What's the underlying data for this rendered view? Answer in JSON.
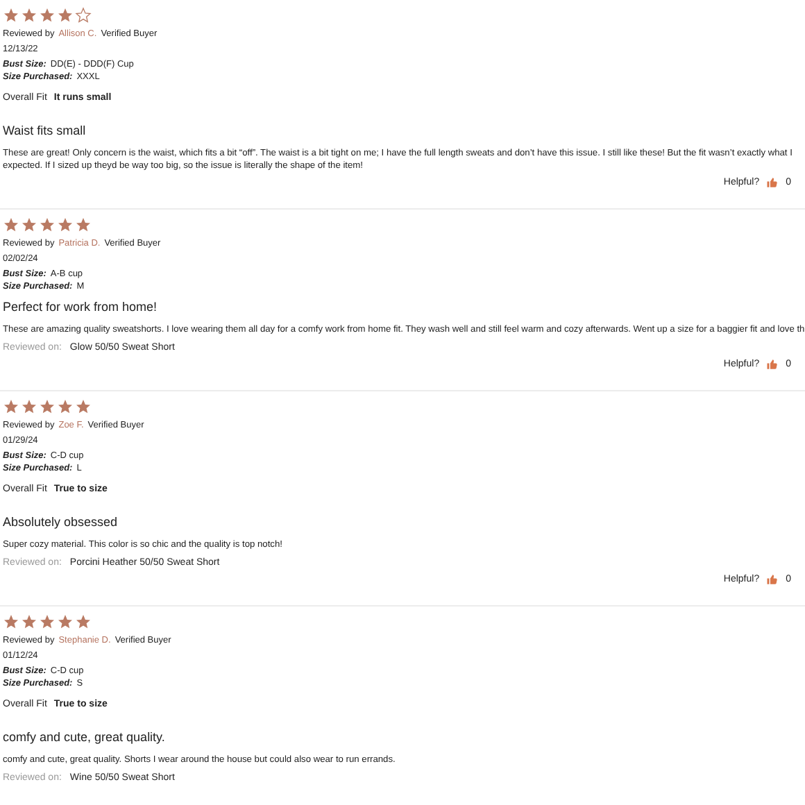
{
  "reviews": [
    {
      "stars": 4,
      "reviewed_by_label": "Reviewed by",
      "reviewer": "Allison C.",
      "badge": "Verified Buyer",
      "date": "12/13/22",
      "bust_size_label": "Bust Size:",
      "bust_size": "DD(E) - DDD(F) Cup",
      "size_purchased_label": "Size Purchased:",
      "size_purchased": "XXXL",
      "overall_fit_label": "Overall Fit",
      "overall_fit": "It runs small",
      "title": "Waist fits small",
      "body": [
        "These are great! Only concern is the waist, which fits a bit “off”. The waist is a bit tight on me; I have the full length sweats and don’t have this issue. I still like these! But the fit wasn’t exactly what I",
        "expected. If I sized up theyd be way too big, so the issue is literally the shape of the item!"
      ],
      "helpful_label": "Helpful?",
      "helpful_count": "0"
    },
    {
      "stars": 5,
      "reviewed_by_label": "Reviewed by",
      "reviewer": "Patricia D.",
      "badge": "Verified Buyer",
      "date": "02/02/24",
      "bust_size_label": "Bust Size:",
      "bust_size": "A-B cup",
      "size_purchased_label": "Size Purchased:",
      "size_purchased": "M",
      "title": "Perfect for work from home!",
      "body": [
        "These are amazing quality sweatshorts. I love wearing them all day for a comfy work from home fit. They wash well and still feel warm and cozy afterwards. Went up a size for a baggier fit and love th"
      ],
      "reviewed_on_label": "Reviewed on:",
      "reviewed_on": "Glow 50/50 Sweat Short",
      "helpful_label": "Helpful?",
      "helpful_count": "0"
    },
    {
      "stars": 5,
      "reviewed_by_label": "Reviewed by",
      "reviewer": "Zoe F.",
      "badge": "Verified Buyer",
      "date": "01/29/24",
      "bust_size_label": "Bust Size:",
      "bust_size": "C-D cup",
      "size_purchased_label": "Size Purchased:",
      "size_purchased": "L",
      "overall_fit_label": "Overall Fit",
      "overall_fit": "True to size",
      "title": "Absolutely obsessed",
      "body": [
        "Super cozy material. This color is so chic and the quality is top notch!"
      ],
      "reviewed_on_label": "Reviewed on:",
      "reviewed_on": "Porcini Heather 50/50 Sweat Short",
      "helpful_label": "Helpful?",
      "helpful_count": "0"
    },
    {
      "stars": 5,
      "reviewed_by_label": "Reviewed by",
      "reviewer": "Stephanie D.",
      "badge": "Verified Buyer",
      "date": "01/12/24",
      "bust_size_label": "Bust Size:",
      "bust_size": "C-D cup",
      "size_purchased_label": "Size Purchased:",
      "size_purchased": "S",
      "overall_fit_label": "Overall Fit",
      "overall_fit": "True to size",
      "title": "comfy and cute, great quality.",
      "body": [
        "comfy and cute, great quality. Shorts I wear around the house but could also wear to run errands."
      ],
      "reviewed_on_label": "Reviewed on:",
      "reviewed_on": "Wine 50/50 Sweat Short"
    }
  ]
}
